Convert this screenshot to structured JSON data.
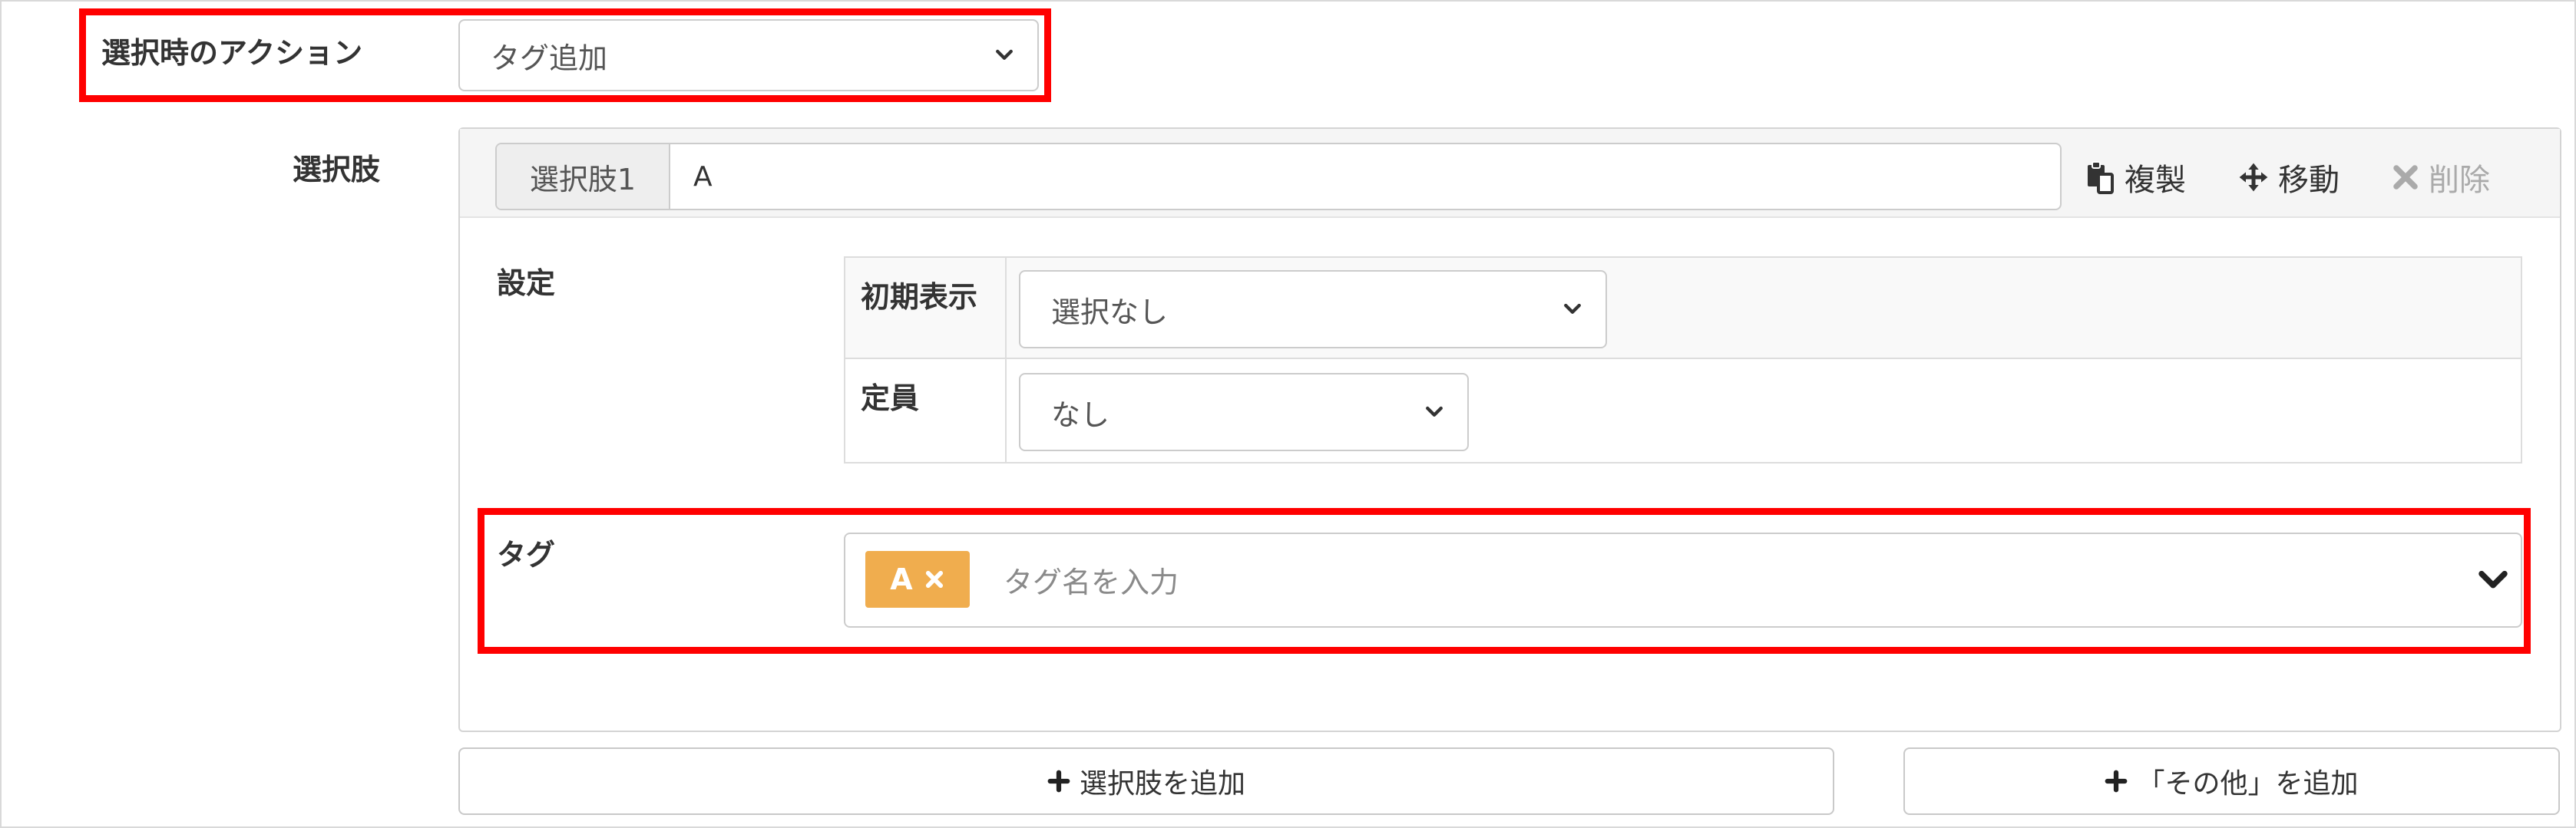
{
  "action_row": {
    "label": "選択時のアクション",
    "selected": "タグ追加"
  },
  "choices_section": {
    "label": "選択肢",
    "choice": {
      "addon": "選択肢1",
      "value": "A"
    },
    "toolbar": {
      "duplicate": "複製",
      "move": "移動",
      "delete": "削除"
    },
    "settings": {
      "label": "設定",
      "initial_label": "初期表示",
      "initial_value": "選択なし",
      "capacity_label": "定員",
      "capacity_value": "なし"
    },
    "tag": {
      "label": "タグ",
      "chip": "A",
      "placeholder": "タグ名を入力"
    }
  },
  "footer": {
    "add_choice": "選択肢を追加",
    "add_other": "「その他」を追加"
  },
  "colors": {
    "highlight": "#ff0000",
    "chip": "#f0ad4e",
    "delete_disabled": "#aaaaaa"
  }
}
